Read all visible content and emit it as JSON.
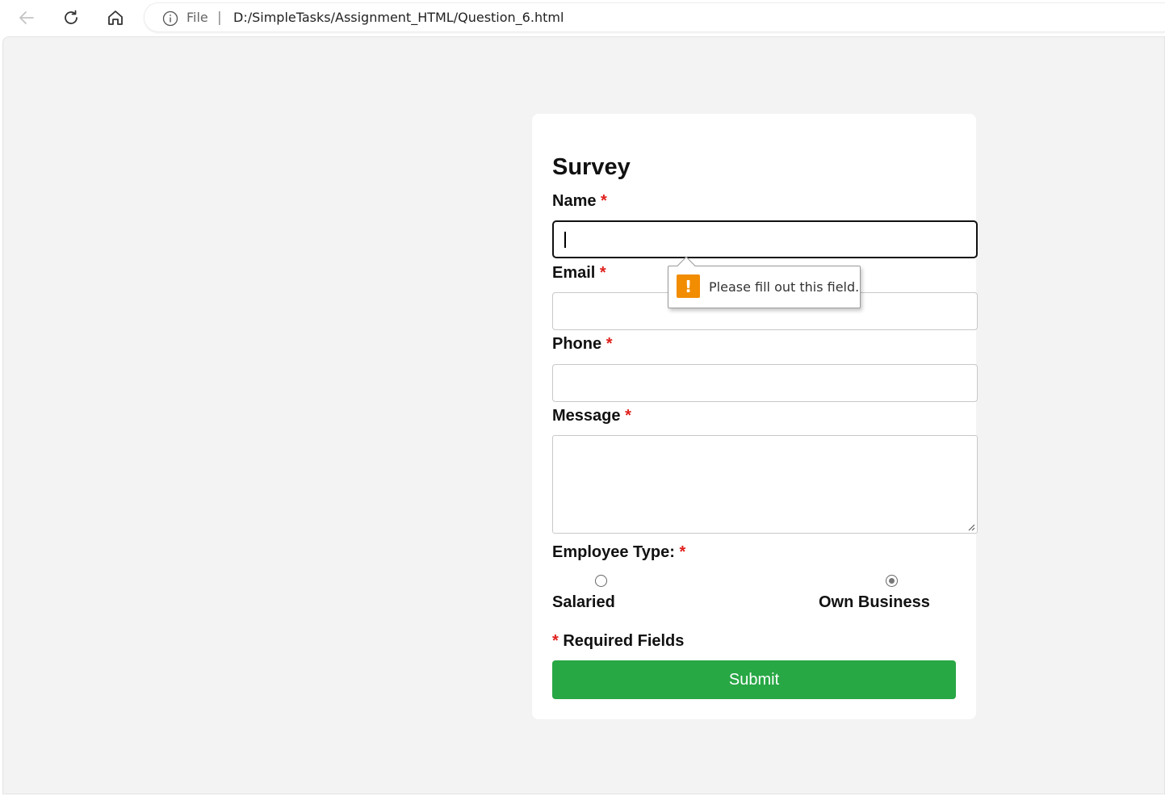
{
  "browser": {
    "site_label": "File",
    "separator": "|",
    "url": "D:/SimpleTasks/Assignment_HTML/Question_6.html"
  },
  "form": {
    "title": "Survey",
    "required_mark": "*",
    "fields": {
      "name": {
        "label": "Name",
        "value": ""
      },
      "email": {
        "label": "Email",
        "value": ""
      },
      "phone": {
        "label": "Phone",
        "value": ""
      },
      "message": {
        "label": "Message",
        "value": ""
      }
    },
    "employee_type": {
      "label": "Employee Type:",
      "options": [
        {
          "label": "Salaried",
          "checked": false
        },
        {
          "label": "Own Business",
          "checked": true
        }
      ]
    },
    "required_note": "Required Fields",
    "submit_label": "Submit"
  },
  "tooltip": {
    "message": "Please fill out this field.",
    "icon": "warning-icon",
    "icon_color": "#f28c00"
  },
  "colors": {
    "submit": "#28a745",
    "required": "#e0201c",
    "page_bg": "#f3f3f3"
  }
}
